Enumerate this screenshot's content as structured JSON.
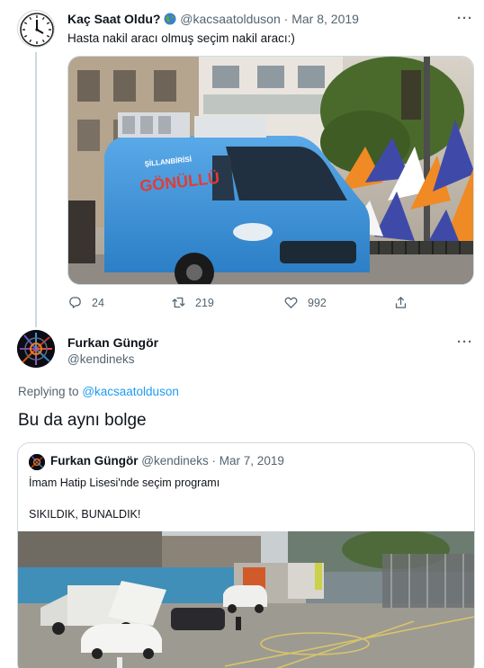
{
  "tweet1": {
    "display_name": "Kaç Saat Oldu?",
    "handle": "@kacsaatolduson",
    "separator": "·",
    "date": "Mar 8, 2019",
    "text": "Hasta nakil aracı olmuş seçim nakil aracı:)",
    "more": "···",
    "avatar_icon": "clock-icon",
    "badge_icon": "globe-icon",
    "stats": {
      "replies": "24",
      "retweets": "219",
      "likes": "992"
    },
    "media_sign_text": "GÖNÜLLÜ",
    "media_sign_small": "ŞİLLANBİRİSİ"
  },
  "tweet2": {
    "display_name": "Furkan Güngör",
    "handle": "@kendineks",
    "more": "···",
    "replying_prefix": "Replying to",
    "replying_to": "@kacsaatolduson",
    "text": "Bu da aynı bolge"
  },
  "quoted": {
    "display_name": "Furkan Güngör",
    "handle": "@kendineks",
    "separator": "·",
    "date": "Mar 7, 2019",
    "line1": "İmam Hatip Lisesi'nde seçim programı",
    "line2": "SIKILDIK, BUNALDIK!"
  },
  "colors": {
    "accent": "#1d9bf0",
    "muted": "#536471",
    "border": "#cfd9de",
    "van_blue": "#2f8fd8"
  }
}
